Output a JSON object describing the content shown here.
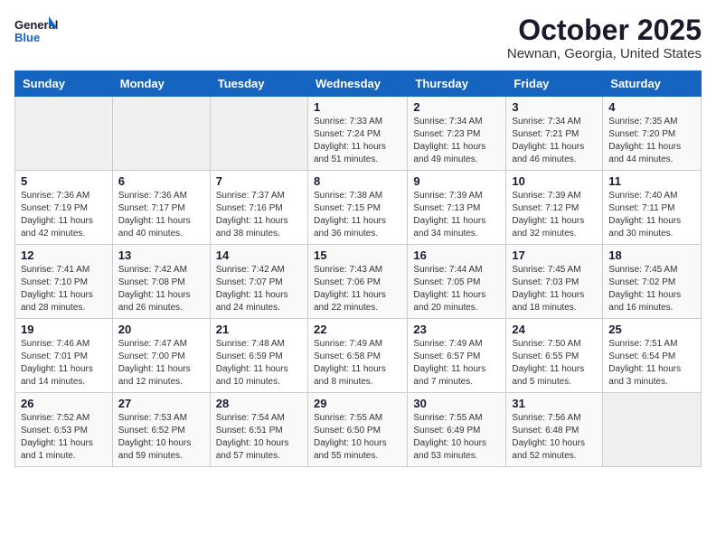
{
  "logo": {
    "line1": "General",
    "line2": "Blue"
  },
  "title": "October 2025",
  "subtitle": "Newnan, Georgia, United States",
  "days_of_week": [
    "Sunday",
    "Monday",
    "Tuesday",
    "Wednesday",
    "Thursday",
    "Friday",
    "Saturday"
  ],
  "weeks": [
    [
      {
        "num": "",
        "info": ""
      },
      {
        "num": "",
        "info": ""
      },
      {
        "num": "",
        "info": ""
      },
      {
        "num": "1",
        "info": "Sunrise: 7:33 AM\nSunset: 7:24 PM\nDaylight: 11 hours\nand 51 minutes."
      },
      {
        "num": "2",
        "info": "Sunrise: 7:34 AM\nSunset: 7:23 PM\nDaylight: 11 hours\nand 49 minutes."
      },
      {
        "num": "3",
        "info": "Sunrise: 7:34 AM\nSunset: 7:21 PM\nDaylight: 11 hours\nand 46 minutes."
      },
      {
        "num": "4",
        "info": "Sunrise: 7:35 AM\nSunset: 7:20 PM\nDaylight: 11 hours\nand 44 minutes."
      }
    ],
    [
      {
        "num": "5",
        "info": "Sunrise: 7:36 AM\nSunset: 7:19 PM\nDaylight: 11 hours\nand 42 minutes."
      },
      {
        "num": "6",
        "info": "Sunrise: 7:36 AM\nSunset: 7:17 PM\nDaylight: 11 hours\nand 40 minutes."
      },
      {
        "num": "7",
        "info": "Sunrise: 7:37 AM\nSunset: 7:16 PM\nDaylight: 11 hours\nand 38 minutes."
      },
      {
        "num": "8",
        "info": "Sunrise: 7:38 AM\nSunset: 7:15 PM\nDaylight: 11 hours\nand 36 minutes."
      },
      {
        "num": "9",
        "info": "Sunrise: 7:39 AM\nSunset: 7:13 PM\nDaylight: 11 hours\nand 34 minutes."
      },
      {
        "num": "10",
        "info": "Sunrise: 7:39 AM\nSunset: 7:12 PM\nDaylight: 11 hours\nand 32 minutes."
      },
      {
        "num": "11",
        "info": "Sunrise: 7:40 AM\nSunset: 7:11 PM\nDaylight: 11 hours\nand 30 minutes."
      }
    ],
    [
      {
        "num": "12",
        "info": "Sunrise: 7:41 AM\nSunset: 7:10 PM\nDaylight: 11 hours\nand 28 minutes."
      },
      {
        "num": "13",
        "info": "Sunrise: 7:42 AM\nSunset: 7:08 PM\nDaylight: 11 hours\nand 26 minutes."
      },
      {
        "num": "14",
        "info": "Sunrise: 7:42 AM\nSunset: 7:07 PM\nDaylight: 11 hours\nand 24 minutes."
      },
      {
        "num": "15",
        "info": "Sunrise: 7:43 AM\nSunset: 7:06 PM\nDaylight: 11 hours\nand 22 minutes."
      },
      {
        "num": "16",
        "info": "Sunrise: 7:44 AM\nSunset: 7:05 PM\nDaylight: 11 hours\nand 20 minutes."
      },
      {
        "num": "17",
        "info": "Sunrise: 7:45 AM\nSunset: 7:03 PM\nDaylight: 11 hours\nand 18 minutes."
      },
      {
        "num": "18",
        "info": "Sunrise: 7:45 AM\nSunset: 7:02 PM\nDaylight: 11 hours\nand 16 minutes."
      }
    ],
    [
      {
        "num": "19",
        "info": "Sunrise: 7:46 AM\nSunset: 7:01 PM\nDaylight: 11 hours\nand 14 minutes."
      },
      {
        "num": "20",
        "info": "Sunrise: 7:47 AM\nSunset: 7:00 PM\nDaylight: 11 hours\nand 12 minutes."
      },
      {
        "num": "21",
        "info": "Sunrise: 7:48 AM\nSunset: 6:59 PM\nDaylight: 11 hours\nand 10 minutes."
      },
      {
        "num": "22",
        "info": "Sunrise: 7:49 AM\nSunset: 6:58 PM\nDaylight: 11 hours\nand 8 minutes."
      },
      {
        "num": "23",
        "info": "Sunrise: 7:49 AM\nSunset: 6:57 PM\nDaylight: 11 hours\nand 7 minutes."
      },
      {
        "num": "24",
        "info": "Sunrise: 7:50 AM\nSunset: 6:55 PM\nDaylight: 11 hours\nand 5 minutes."
      },
      {
        "num": "25",
        "info": "Sunrise: 7:51 AM\nSunset: 6:54 PM\nDaylight: 11 hours\nand 3 minutes."
      }
    ],
    [
      {
        "num": "26",
        "info": "Sunrise: 7:52 AM\nSunset: 6:53 PM\nDaylight: 11 hours\nand 1 minute."
      },
      {
        "num": "27",
        "info": "Sunrise: 7:53 AM\nSunset: 6:52 PM\nDaylight: 10 hours\nand 59 minutes."
      },
      {
        "num": "28",
        "info": "Sunrise: 7:54 AM\nSunset: 6:51 PM\nDaylight: 10 hours\nand 57 minutes."
      },
      {
        "num": "29",
        "info": "Sunrise: 7:55 AM\nSunset: 6:50 PM\nDaylight: 10 hours\nand 55 minutes."
      },
      {
        "num": "30",
        "info": "Sunrise: 7:55 AM\nSunset: 6:49 PM\nDaylight: 10 hours\nand 53 minutes."
      },
      {
        "num": "31",
        "info": "Sunrise: 7:56 AM\nSunset: 6:48 PM\nDaylight: 10 hours\nand 52 minutes."
      },
      {
        "num": "",
        "info": ""
      }
    ]
  ]
}
